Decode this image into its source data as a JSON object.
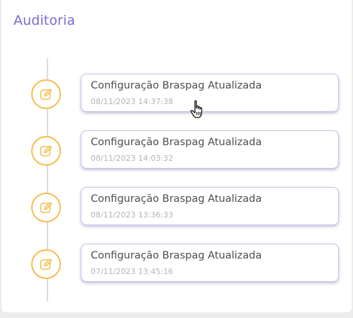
{
  "panel": {
    "title": "Auditoria"
  },
  "timeline": {
    "entries": [
      {
        "icon": "edit-icon",
        "title": "Configuração Braspag Atualizada",
        "date": "08/11/2023 14:37:38"
      },
      {
        "icon": "edit-icon",
        "title": "Configuração Braspag Atualizada",
        "date": "08/11/2023 14:03:32"
      },
      {
        "icon": "edit-icon",
        "title": "Configuração Braspag Atualizada",
        "date": "08/11/2023 13:36:33"
      },
      {
        "icon": "edit-icon",
        "title": "Configuração Braspag Atualizada",
        "date": "07/11/2023 13:45:16"
      }
    ]
  },
  "cursor": {
    "icon": "hand-pointer-icon"
  },
  "colors": {
    "title": "#7a6cd0",
    "marker_border": "#f5be4e",
    "card_border": "#c9c3ef",
    "background": "#ececec"
  }
}
